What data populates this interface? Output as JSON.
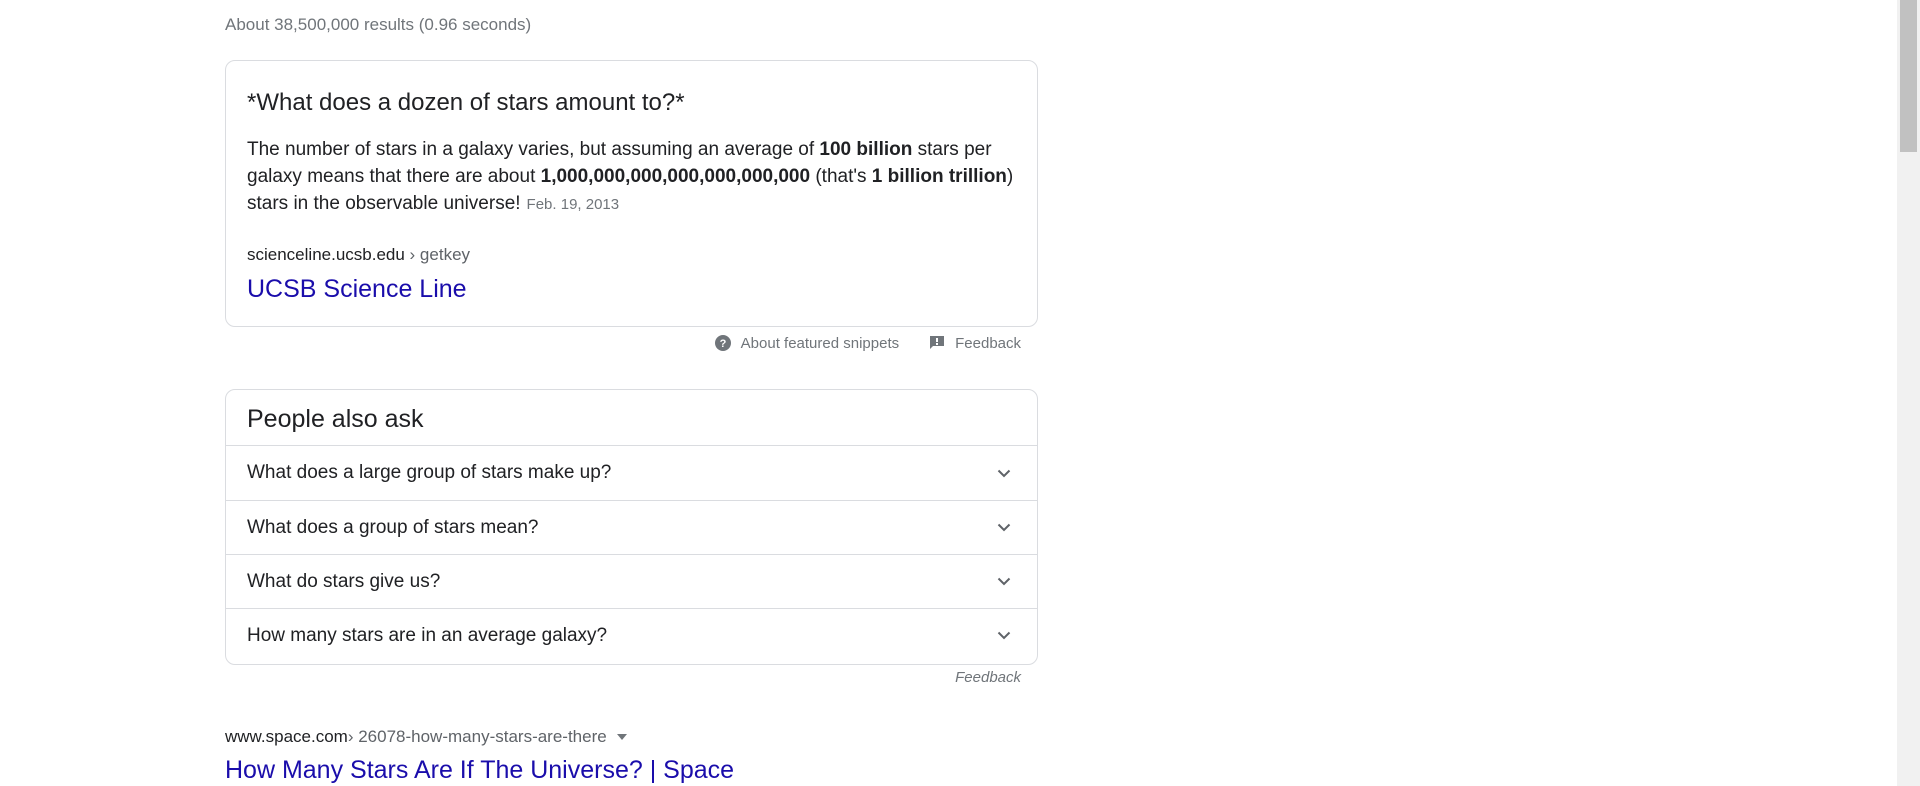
{
  "results_stats": "About 38,500,000 results (0.96 seconds)",
  "featured_snippet": {
    "question": "*What does a dozen of stars amount to?*",
    "text_segments": [
      {
        "text": "The number of stars in a galaxy varies, but assuming an average of ",
        "bold": false
      },
      {
        "text": "100 billion",
        "bold": true
      },
      {
        "text": " stars per galaxy means that there are about ",
        "bold": false
      },
      {
        "text": "1,000,000,000,000,000,000,000",
        "bold": true
      },
      {
        "text": " (that's ",
        "bold": false
      },
      {
        "text": "1 billion trillion",
        "bold": true
      },
      {
        "text": ") stars in the observable universe!",
        "bold": false
      }
    ],
    "date": "Feb. 19, 2013",
    "cite_domain": "scienceline.ucsb.edu",
    "cite_path": " › getkey",
    "title": "UCSB Science Line"
  },
  "snippet_footer": {
    "about_label": "About featured snippets",
    "feedback_label": "Feedback"
  },
  "people_also_ask": {
    "title": "People also ask",
    "questions": [
      "What does a large group of stars make up?",
      "What does a group of stars mean?",
      "What do stars give us?",
      "How many stars are in an average galaxy?"
    ],
    "feedback_label": "Feedback"
  },
  "result": {
    "cite_domain": "www.space.com",
    "cite_path": " › 26078-how-many-stars-are-there",
    "title": "How Many Stars Are If The Universe? | Space"
  },
  "colors": {
    "link": "#1a0dab",
    "text": "#202124",
    "secondary": "#70757a",
    "border": "#dadce0"
  }
}
